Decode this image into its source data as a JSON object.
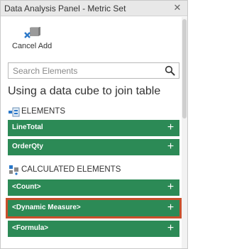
{
  "window": {
    "title": "Data Analysis Panel - Metric Set",
    "close_icon": "close-icon"
  },
  "toolbar": {
    "cancel_add_label": "Cancel Add",
    "cancel_add_icon": "cube-cancel-icon"
  },
  "search": {
    "placeholder": "Search Elements",
    "value": "",
    "icon": "search-icon"
  },
  "cube_title": "Using a data cube to join table",
  "sections": {
    "elements": {
      "label": "ELEMENTS",
      "icon": "elements-icon",
      "items": [
        {
          "label": "LineTotal",
          "icon": "plus-icon"
        },
        {
          "label": "OrderQty",
          "icon": "plus-icon"
        }
      ]
    },
    "calculated": {
      "label": "CALCULATED ELEMENTS",
      "icon": "calculated-elements-icon",
      "items": [
        {
          "label": "<Count>",
          "icon": "plus-icon"
        },
        {
          "label": "<Dynamic Measure>",
          "icon": "plus-icon",
          "selected": true
        },
        {
          "label": "<Formula>",
          "icon": "plus-icon"
        }
      ]
    }
  },
  "colors": {
    "item_background": "#2c8a56",
    "selected_outline": "#c9502c",
    "titlebar_background": "#e8e8e8"
  }
}
